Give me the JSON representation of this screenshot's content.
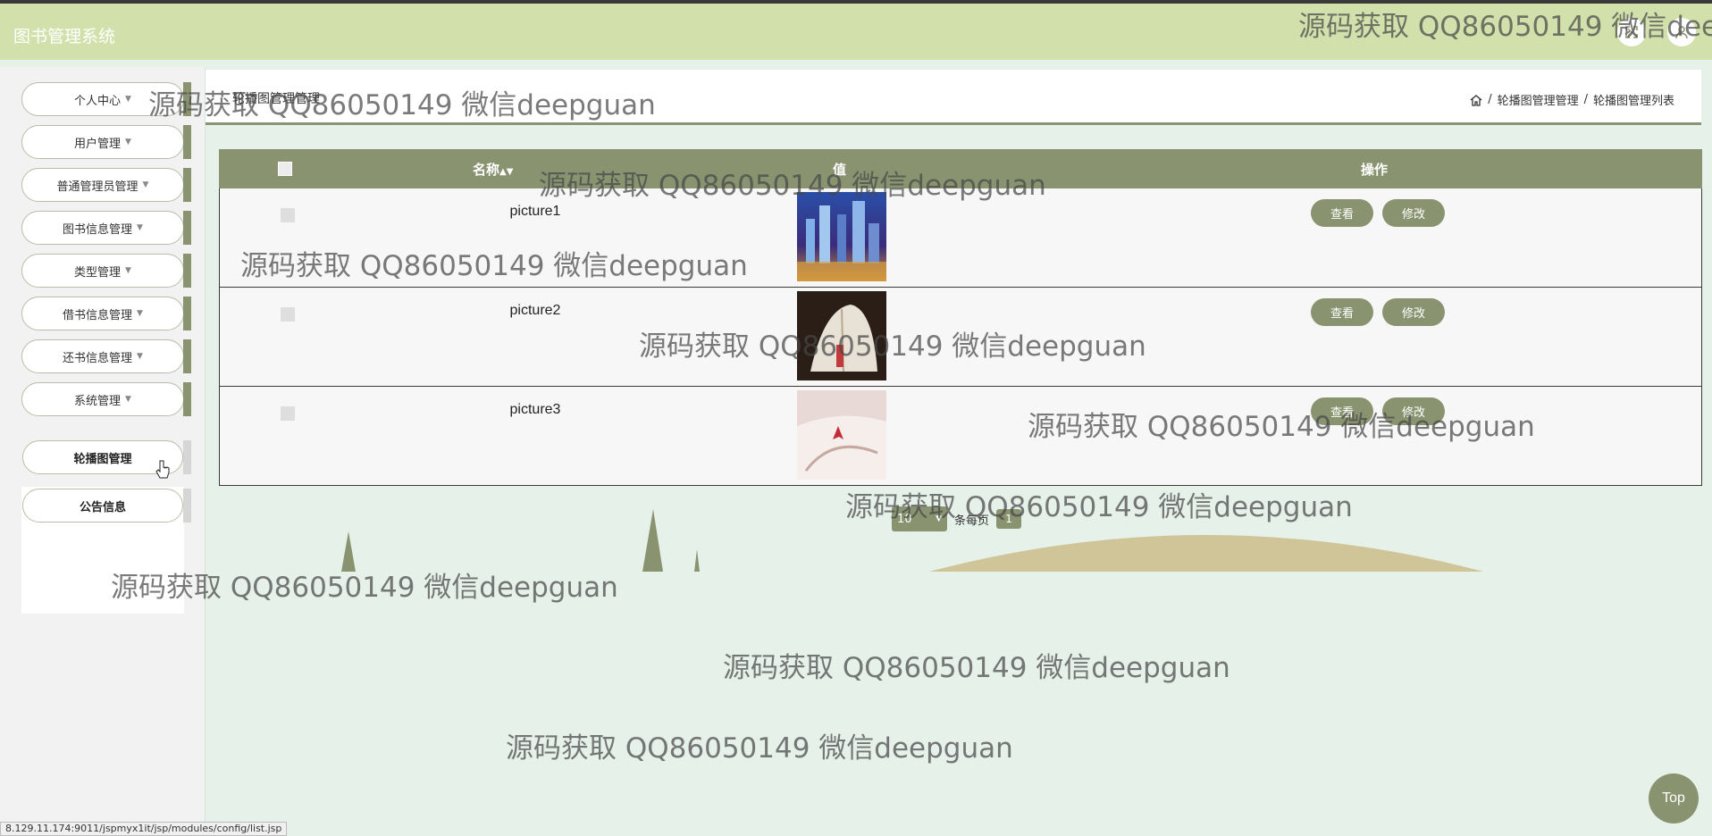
{
  "app": {
    "title": "图书管理系统"
  },
  "header": {
    "icons": [
      "fullscreen-icon",
      "user-icon"
    ]
  },
  "sidebar": {
    "items": [
      {
        "label": "个人中心"
      },
      {
        "label": "用户管理"
      },
      {
        "label": "普通管理员管理"
      },
      {
        "label": "图书信息管理"
      },
      {
        "label": "类型管理"
      },
      {
        "label": "借书信息管理"
      },
      {
        "label": "还书信息管理"
      },
      {
        "label": "系统管理"
      }
    ],
    "sub_items": [
      {
        "label": "轮播图管理"
      },
      {
        "label": "公告信息"
      }
    ]
  },
  "page": {
    "title": "轮播图管理管理",
    "breadcrumb": [
      "轮播图管理管理",
      "轮播图管理列表"
    ]
  },
  "table": {
    "headers": {
      "name": "名称",
      "value": "值",
      "actions": "操作"
    },
    "rows": [
      {
        "name": "picture1",
        "view": "查看",
        "edit": "修改"
      },
      {
        "name": "picture2",
        "view": "查看",
        "edit": "修改"
      },
      {
        "name": "picture3",
        "view": "查看",
        "edit": "修改"
      }
    ]
  },
  "pager": {
    "page_size": "10",
    "per_page_label": "条每页",
    "current_page": "1"
  },
  "footer": {
    "status_url": "8.129.11.174:9011/jspmyx1it/jsp/modules/config/list.jsp",
    "top_label": "Top"
  },
  "watermark": {
    "text": "源码获取 QQ86050149 微信deepguan"
  },
  "colors": {
    "accent": "#8a9370",
    "header_bg": "#d2e1ac",
    "page_bg": "#e6f1ea",
    "deco_tan": "#cfc598"
  }
}
